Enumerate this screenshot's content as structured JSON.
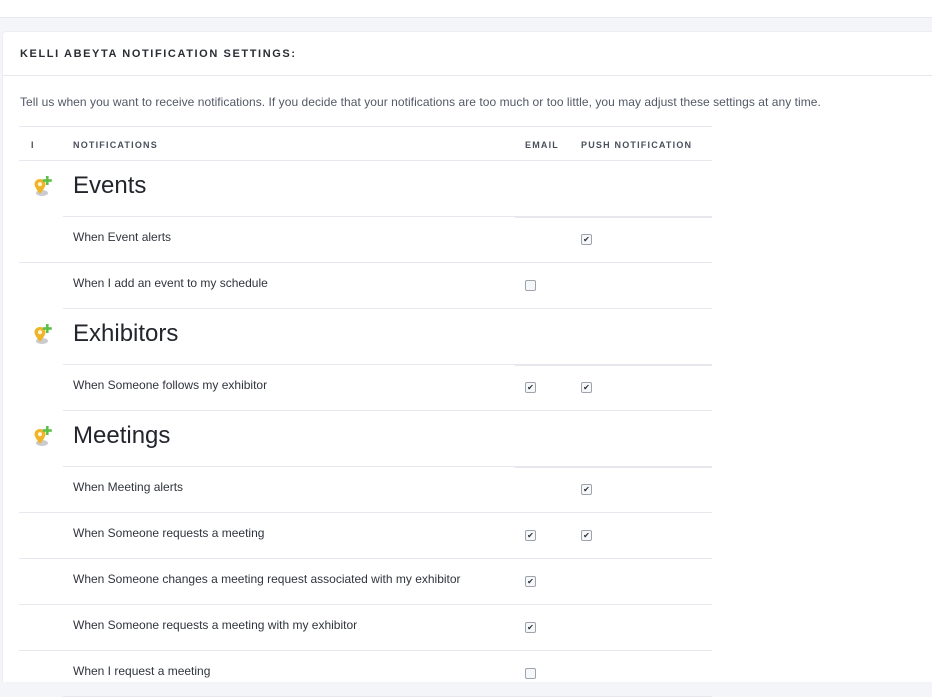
{
  "page": {
    "title": "KELLI ABEYTA NOTIFICATION SETTINGS:",
    "intro": "Tell us when you want to receive notifications. If you decide that your notifications are too much or too little, you may adjust these settings at any time."
  },
  "table": {
    "headers": {
      "icon": "I",
      "notifications": "NOTIFICATIONS",
      "email": "EMAIL",
      "push": "PUSH NOTIFICATION"
    }
  },
  "groups": [
    {
      "title": "Events",
      "icon": "map-pin-plus-icon",
      "items": [
        {
          "label": "When Event alerts",
          "email": null,
          "push": true
        },
        {
          "label": "When I add an event to my schedule",
          "email": false,
          "push": null
        }
      ]
    },
    {
      "title": "Exhibitors",
      "icon": "map-pin-plus-icon",
      "items": [
        {
          "label": "When Someone follows my exhibitor",
          "email": true,
          "push": true
        }
      ]
    },
    {
      "title": "Meetings",
      "icon": "map-pin-plus-icon",
      "items": [
        {
          "label": "When Meeting alerts",
          "email": null,
          "push": true
        },
        {
          "label": "When Someone requests a meeting",
          "email": true,
          "push": true
        },
        {
          "label": "When Someone changes a meeting request associated with my exhibitor",
          "email": true,
          "push": null
        },
        {
          "label": "When Someone requests a meeting with my exhibitor",
          "email": true,
          "push": null
        },
        {
          "label": "When I request a meeting",
          "email": false,
          "push": null
        }
      ]
    }
  ],
  "colors": {
    "pin": "#f0b429",
    "plus": "#5cc04a",
    "border": "#e6e8ee"
  }
}
